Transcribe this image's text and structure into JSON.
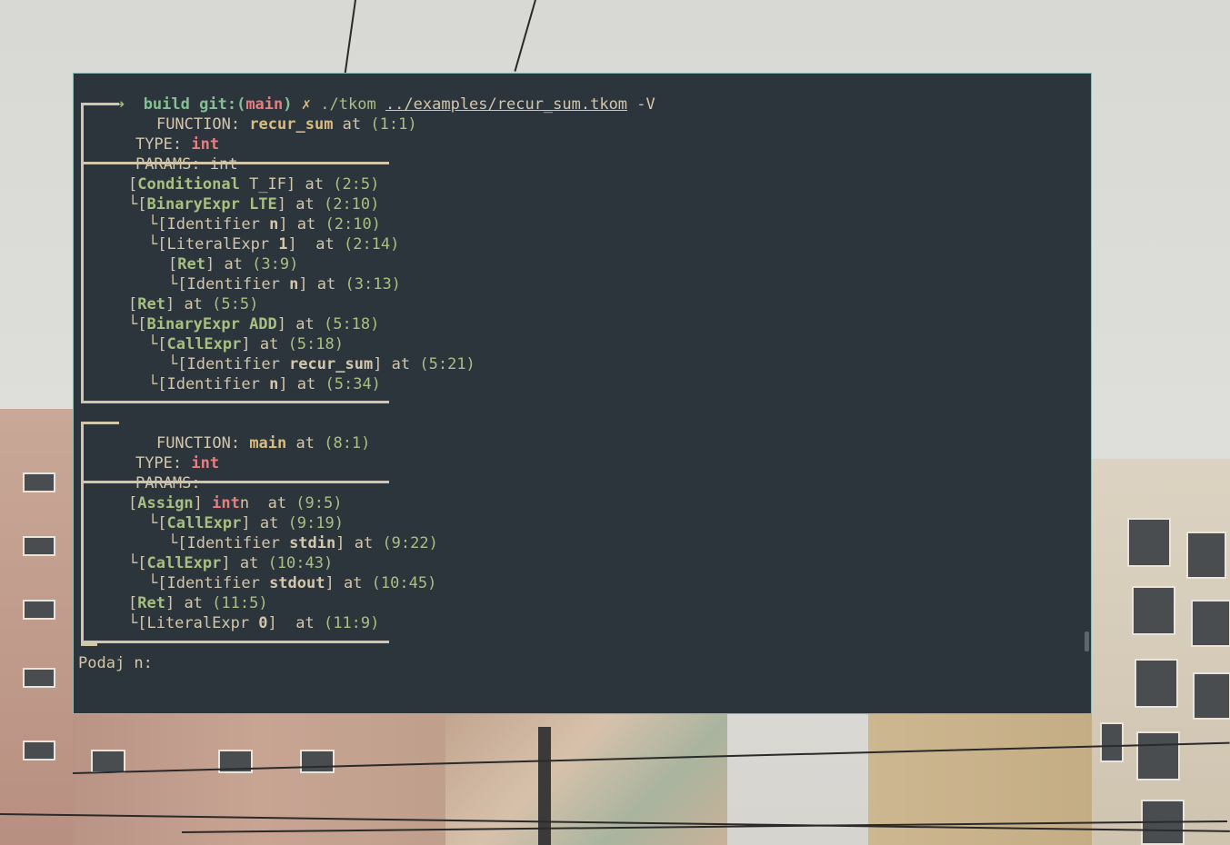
{
  "prompt": {
    "arrow": "➔",
    "dir": "build",
    "git_prefix": "git:(",
    "branch": "main",
    "git_suffix": ")",
    "dirty": "✗",
    "command": "./tkom",
    "arg_path": "../examples/recur_sum.tkom",
    "flag": "-V"
  },
  "functions": [
    {
      "header_label": "FUNCTION: ",
      "name": "recur_sum",
      "at": " at ",
      "pos": "(1:1)",
      "type_label": "TYPE: ",
      "type": "int",
      "params_label": "PARAMS: ",
      "params": "int"
    },
    {
      "header_label": "FUNCTION: ",
      "name": "main",
      "at": " at ",
      "pos": "(8:1)",
      "type_label": "TYPE: ",
      "type": "int",
      "params_label": "PARAMS:",
      "params": ""
    }
  ],
  "tree1": [
    {
      "prefix": "[",
      "kw": "Conditional",
      "rest": " T_IF] at ",
      "pos": "(2:5)"
    },
    {
      "prefix": "└[",
      "kw": "BinaryExpr LTE",
      "rest": "] at ",
      "pos": "(2:10)"
    },
    {
      "prefix": "└[Identifier ",
      "bold": "n",
      "rest": "] at ",
      "pos": "(2:10)"
    },
    {
      "prefix": "└[LiteralExpr ",
      "bold": "1",
      "rest": "]  at ",
      "pos": "(2:14)"
    },
    {
      "prefix": "[",
      "kw": "Ret",
      "rest": "] at ",
      "pos": "(3:9)"
    },
    {
      "prefix": "└[Identifier ",
      "bold": "n",
      "rest": "] at ",
      "pos": "(3:13)"
    },
    {
      "prefix": "[",
      "kw": "Ret",
      "rest": "] at ",
      "pos": "(5:5)"
    },
    {
      "prefix": "└[",
      "kw": "BinaryExpr ADD",
      "rest": "] at ",
      "pos": "(5:18)"
    },
    {
      "prefix": "└[",
      "kw": "CallExpr",
      "rest": "] at ",
      "pos": "(5:18)"
    },
    {
      "prefix": "└[Identifier ",
      "bold": "recur_sum",
      "rest": "] at ",
      "pos": "(5:21)"
    },
    {
      "prefix": "└[Identifier ",
      "bold": "n",
      "rest": "] at ",
      "pos": "(5:34)"
    }
  ],
  "tree2": [
    {
      "prefix": "[",
      "kw": "Assign",
      "rest": "] ",
      "red": "int",
      "tail": "n  at ",
      "pos": "(9:5)"
    },
    {
      "prefix": "└[",
      "kw": "CallExpr",
      "rest": "] at ",
      "pos": "(9:19)"
    },
    {
      "prefix": "└[Identifier ",
      "bold": "stdin",
      "rest": "] at ",
      "pos": "(9:22)"
    },
    {
      "prefix": "└[",
      "kw": "CallExpr",
      "rest": "] at ",
      "pos": "(10:43)"
    },
    {
      "prefix": "└[Identifier ",
      "bold": "stdout",
      "rest": "] at ",
      "pos": "(10:45)"
    },
    {
      "prefix": "[",
      "kw": "Ret",
      "rest": "] at ",
      "pos": "(11:5)"
    },
    {
      "prefix": "└[LiteralExpr ",
      "bold": "0",
      "rest": "]  at ",
      "pos": "(11:9)"
    }
  ],
  "input_prompt": "Podaj n:",
  "colors": {
    "terminal_bg": "#2d353c",
    "fg": "#d3c6aa",
    "green": "#a7c080",
    "red": "#e67e80",
    "orange": "#e69875",
    "yellow": "#dbbc7f",
    "aqua": "#83c092"
  }
}
